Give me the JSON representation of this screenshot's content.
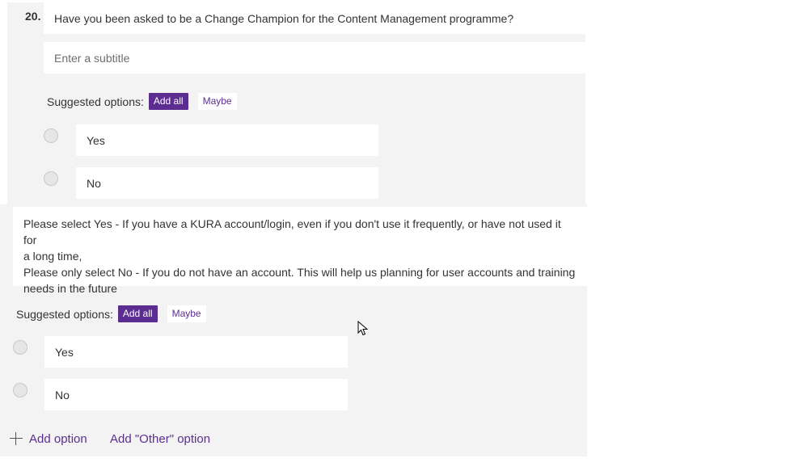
{
  "question1": {
    "number": "20.",
    "title": "Have you been asked to be a Change Champion for the Content Management programme?",
    "subtitle_placeholder": "Enter a subtitle",
    "suggested_label": "Suggested options:",
    "suggested_buttons": {
      "add_all": "Add all",
      "maybe": "Maybe"
    },
    "options": [
      {
        "label": "Yes",
        "icon": "radio-circle-icon"
      },
      {
        "label": "No",
        "icon": "radio-circle-icon"
      }
    ]
  },
  "question2": {
    "description_lines": [
      "Please select Yes - If you have a KURA account/login, even if you don't use it frequently, or have not used it for",
      "a long time,",
      "Please only select No - If you do not have an account.  This will help us planning for user accounts and training",
      "needs in the future"
    ],
    "suggested_label": "Suggested options:",
    "suggested_buttons": {
      "add_all": "Add all",
      "maybe": "Maybe"
    },
    "options": [
      {
        "label": "Yes",
        "icon": "radio-circle-icon"
      },
      {
        "label": "No",
        "icon": "radio-circle-icon"
      }
    ],
    "add_option": "Add option",
    "add_other_option": "Add \"Other\" option"
  },
  "colors": {
    "accent": "#5c2d91",
    "panel_background": "#f3f3f3",
    "field_background": "#ffffff"
  },
  "icons": {
    "plus": "plus-icon",
    "cursor": "mouse-pointer-icon"
  }
}
